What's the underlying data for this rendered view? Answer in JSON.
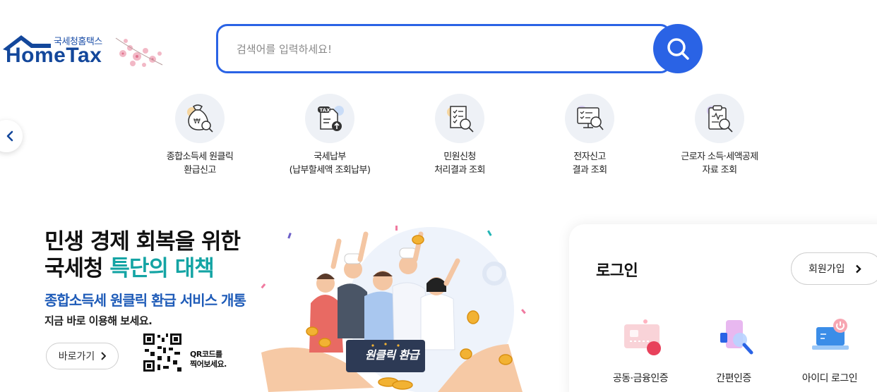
{
  "logo": {
    "sub_text": "국세청홈택스",
    "brand_text": "HomeTax",
    "icon": "house-roof-icon"
  },
  "search": {
    "placeholder": "검색어를 입력하세요!",
    "value": "",
    "icon": "search-icon"
  },
  "nav": {
    "prev_icon": "chevron-left-icon"
  },
  "quick_menu": [
    {
      "label": "종합소득세 원클릭\n환급신고",
      "icon": "money-bag-search-icon"
    },
    {
      "label": "국세납부\n(납부할세액 조회납부)",
      "icon": "tax-document-upload-icon"
    },
    {
      "label": "민원신청\n처리결과 조회",
      "icon": "document-search-icon"
    },
    {
      "label": "전자신고\n결과 조회",
      "icon": "monitor-checklist-search-icon"
    },
    {
      "label": "근로자 소득·세액공제\n자료 조회",
      "icon": "clipboard-search-icon"
    }
  ],
  "banner": {
    "title_line1": "민생 경제 회복을 위한",
    "title_line2_prefix": "국세청 ",
    "title_line2_accent": "특단의 대책",
    "subtitle": "종합소득세 원클릭 환급 서비스 개통",
    "description": "지금 바로 이용해 보세요.",
    "go_label": "바로가기",
    "qr_text": "QR코드를\n찍어보세요.",
    "badge": "원클릭 환급",
    "accent_color": "#14a4a4",
    "sub_color": "#1e5bb8"
  },
  "login": {
    "title": "로그인",
    "signup_label": "회원가입",
    "options": [
      {
        "label": "공동·금융인증",
        "icon": "certificate-card-icon"
      },
      {
        "label": "간편인증",
        "icon": "phone-search-icon"
      },
      {
        "label": "아이디 로그인",
        "icon": "laptop-power-icon"
      }
    ]
  },
  "colors": {
    "primary": "#2a63e5",
    "brand": "#13479b"
  }
}
